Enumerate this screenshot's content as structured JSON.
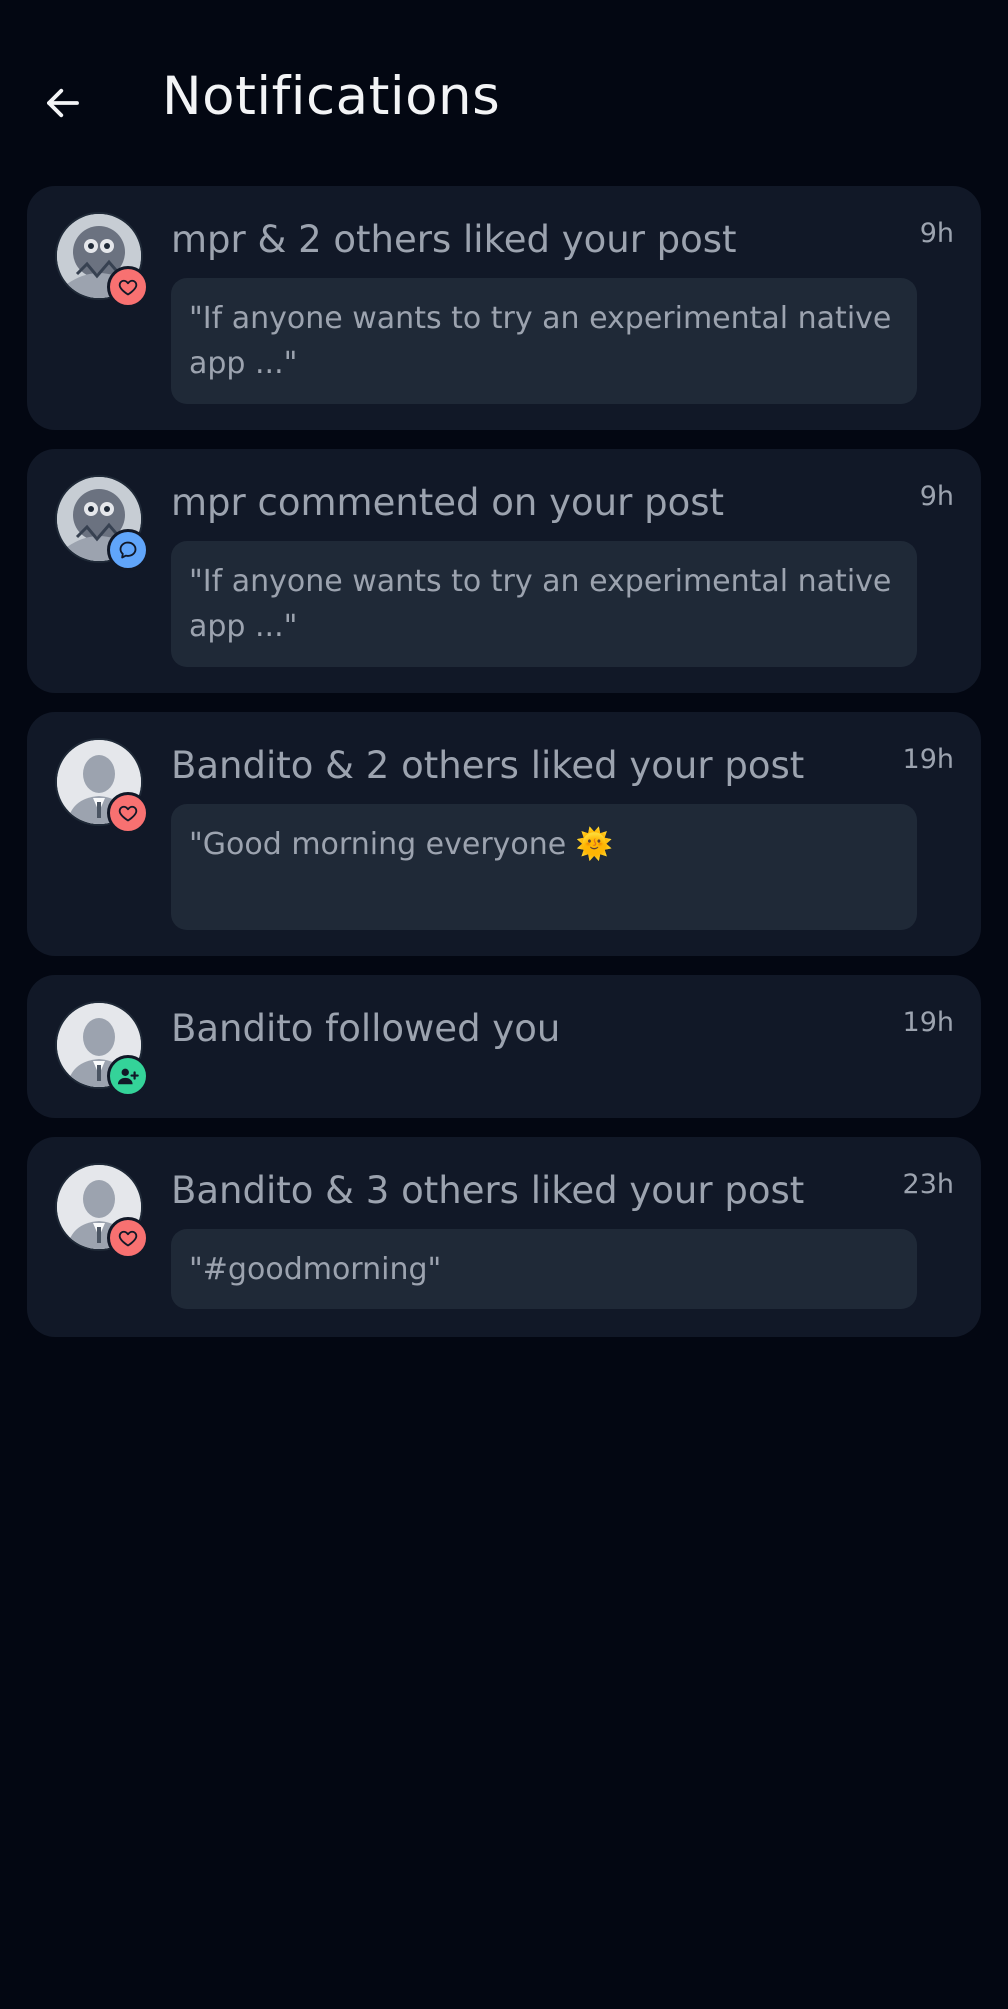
{
  "header": {
    "title": "Notifications",
    "back_icon": "arrow-left-icon"
  },
  "notifications": [
    {
      "title": "mpr & 2 others liked your post",
      "time": "9h",
      "quote": "\"If anyone wants to try an experimental native app ...\"",
      "avatar": "illustration-avatar",
      "badge_icon": "heart-icon",
      "badge_color": "#f87171"
    },
    {
      "title": "mpr commented on your post",
      "time": "9h",
      "quote": "\"If anyone wants to try an experimental native app ...\"",
      "avatar": "illustration-avatar",
      "badge_icon": "comment-icon",
      "badge_color": "#60a5fa"
    },
    {
      "title": "Bandito & 2 others liked your post",
      "time": "19h",
      "quote": "\"Good morning everyone 🌞",
      "avatar": "default-person-avatar",
      "badge_icon": "heart-icon",
      "badge_color": "#f87171"
    },
    {
      "title": "Bandito followed you",
      "time": "19h",
      "avatar": "default-person-avatar",
      "badge_icon": "user-plus-icon",
      "badge_color": "#34d399"
    },
    {
      "title": "Bandito & 3 others liked your post",
      "time": "23h",
      "quote": "\"#goodmorning\"",
      "avatar": "default-person-avatar",
      "badge_icon": "heart-icon",
      "badge_color": "#f87171"
    }
  ],
  "colors": {
    "background": "#030712",
    "card": "#111827",
    "quote_bg": "#1f2937",
    "text_muted": "#9ca3af",
    "title": "#f3f4f6"
  }
}
